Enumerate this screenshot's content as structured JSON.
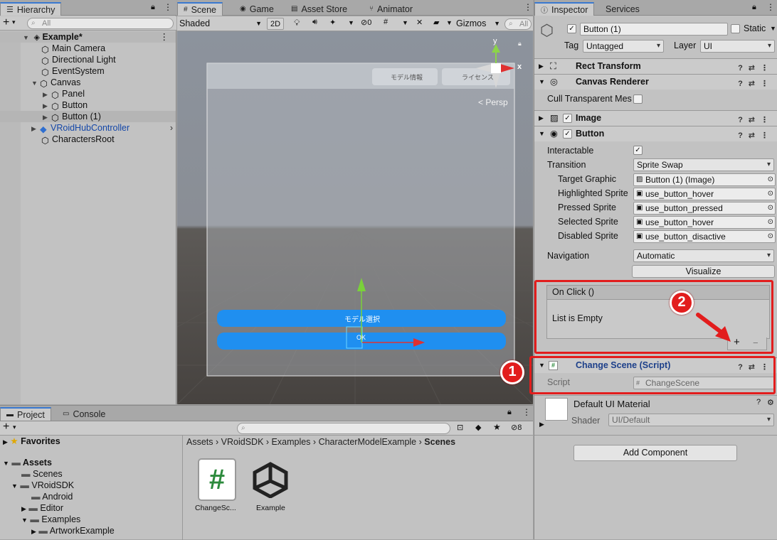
{
  "hierarchy": {
    "tab": "Hierarchy",
    "search_placeholder": "All",
    "add_label": "+",
    "items": [
      {
        "label": "Example*"
      },
      {
        "label": "Main Camera"
      },
      {
        "label": "Directional Light"
      },
      {
        "label": "EventSystem"
      },
      {
        "label": "Canvas"
      },
      {
        "label": "Panel"
      },
      {
        "label": "Button"
      },
      {
        "label": "Button (1)"
      },
      {
        "label": "VRoidHubController"
      },
      {
        "label": "CharactersRoot"
      }
    ]
  },
  "scene": {
    "tabs": [
      "Scene",
      "Game",
      "Asset Store",
      "Animator"
    ],
    "shading": "Shaded",
    "mode_2d": "2D",
    "hidden_count": "0",
    "gizmos": "Gizmos",
    "search_placeholder": "All",
    "persp": "< Persp",
    "overlay": {
      "tab_model_info": "モデル情報",
      "tab_license": "ライセンス",
      "btn_select": "モデル選択",
      "btn_ok": "OK"
    },
    "axis": {
      "x": "x",
      "y": "y"
    }
  },
  "inspector": {
    "tabs": [
      "Inspector",
      "Services"
    ],
    "object_name": "Button (1)",
    "static_label": "Static",
    "tag_label": "Tag",
    "tag_value": "Untagged",
    "layer_label": "Layer",
    "layer_value": "UI",
    "components": {
      "rect": "Rect Transform",
      "canvas_renderer": "Canvas Renderer",
      "cull_label": "Cull Transparent Mes",
      "image": "Image",
      "button": "Button",
      "change_scene": "Change Scene (Script)"
    },
    "button": {
      "interactable": "Interactable",
      "transition": "Transition",
      "transition_value": "Sprite Swap",
      "target_graphic": "Target Graphic",
      "target_graphic_value": "Button (1) (Image)",
      "highlighted": "Highlighted Sprite",
      "highlighted_value": "use_button_hover",
      "pressed": "Pressed Sprite",
      "pressed_value": "use_button_pressed",
      "selected": "Selected Sprite",
      "selected_value": "use_button_hover",
      "disabled": "Disabled Sprite",
      "disabled_value": "use_button_disactive",
      "navigation": "Navigation",
      "navigation_value": "Automatic",
      "visualize": "Visualize"
    },
    "onclick": {
      "header": "On Click ()",
      "empty": "List is Empty",
      "plus": "+",
      "minus": "−"
    },
    "script": {
      "label": "Script",
      "value": "ChangeScene"
    },
    "material": {
      "name": "Default UI Material",
      "shader_label": "Shader",
      "shader_value": "UI/Default"
    },
    "add_component": "Add Component"
  },
  "annotations": {
    "one": "1",
    "two": "2"
  },
  "project": {
    "tabs": [
      "Project",
      "Console"
    ],
    "hidden_count": "8",
    "favorites": "Favorites",
    "assets": "Assets",
    "tree": [
      "Scenes",
      "VRoidSDK",
      "Android",
      "Editor",
      "Examples",
      "ArtworkExample"
    ],
    "breadcrumb": [
      "Assets",
      "VRoidSDK",
      "Examples",
      "CharacterModelExample",
      "Scenes"
    ],
    "files": [
      {
        "label": "ChangeSc..."
      },
      {
        "label": "Example"
      }
    ]
  },
  "colors": {
    "highlight_red": "#e21d1d",
    "button_blue": "#1f8ff0",
    "tab_accent": "#3a79d0"
  }
}
